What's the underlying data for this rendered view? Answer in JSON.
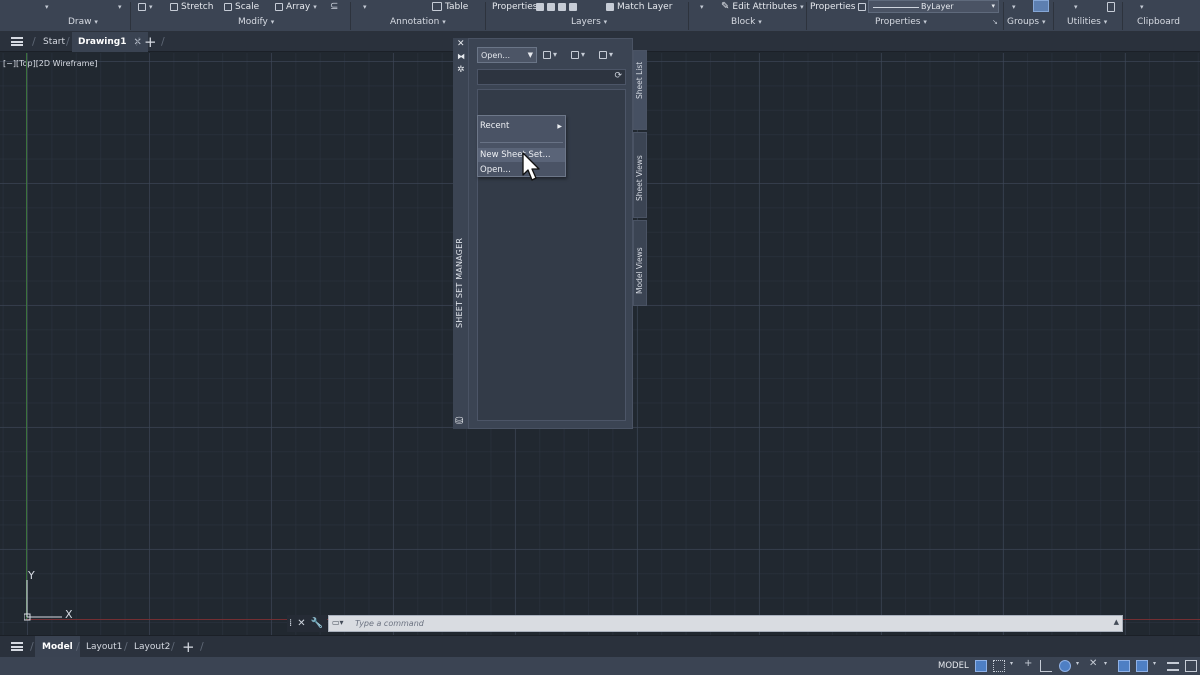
{
  "ribbon": {
    "tools": {
      "stretch": "Stretch",
      "scale": "Scale",
      "array": "Array",
      "table": "Table",
      "properties": "Properties",
      "match_layer": "Match Layer",
      "edit_attributes": "Edit Attributes",
      "properties2": "Properties",
      "bylayer": "ByLayer"
    },
    "panels": {
      "draw": "Draw",
      "modify": "Modify",
      "annotation": "Annotation",
      "layers": "Layers",
      "block": "Block",
      "properties": "Properties",
      "groups": "Groups",
      "utilities": "Utilities",
      "clipboard": "Clipboard"
    }
  },
  "file_tabs": {
    "start": "Start",
    "drawing": "Drawing1"
  },
  "viewport": {
    "label": "[−][Top][2D Wireframe]"
  },
  "ucs": {
    "x": "X",
    "y": "Y"
  },
  "sheet_set_manager": {
    "title": "SHEET SET MANAGER",
    "dropdown_value": "Open...",
    "tabs": {
      "sheet_list": "Sheet List",
      "sheet_views": "Sheet Views",
      "model_views": "Model Views"
    },
    "menu": {
      "recent": "Recent",
      "new_sheet_set": "New Sheet Set...",
      "open": "Open..."
    }
  },
  "command_line": {
    "placeholder": "Type a command"
  },
  "layout_tabs": {
    "model": "Model",
    "layout1": "Layout1",
    "layout2": "Layout2"
  },
  "status_bar": {
    "model": "MODEL"
  },
  "colors": {
    "accent": "#4e7fc4",
    "background": "#212830",
    "panel": "#3b4453"
  }
}
